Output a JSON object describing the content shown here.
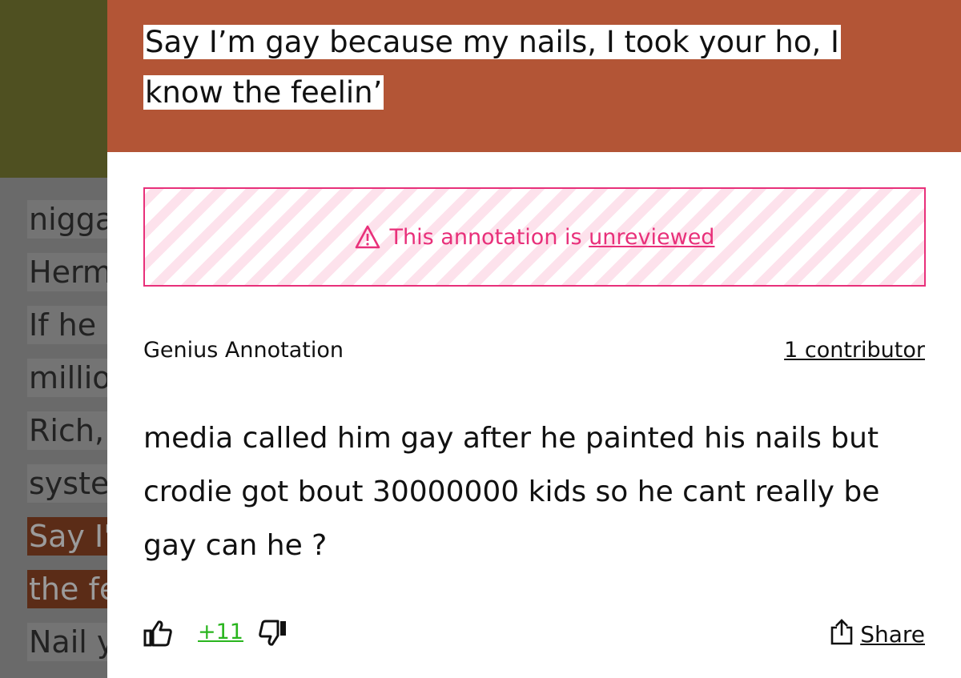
{
  "background_lyrics": [
    {
      "text": "nigga",
      "highlight": false
    },
    {
      "text": "Herm",
      "highlight": false
    },
    {
      "text": "If he",
      "highlight": false
    },
    {
      "text": "millio",
      "highlight": false
    },
    {
      "text": "Rich,",
      "highlight": false
    },
    {
      "text": "syste",
      "highlight": false
    },
    {
      "text": "Say I'",
      "highlight": true
    },
    {
      "text": "the fe",
      "highlight": true
    },
    {
      "text": "Nail y",
      "highlight": false
    }
  ],
  "annotation": {
    "lyric": "Say I’m gay because my nails, I took your ho, I know the feelin’",
    "warning_prefix": "This annotation is ",
    "warning_link": "unreviewed",
    "label": "Genius Annotation",
    "contributors": "1 contributor",
    "body": "media called him gay after he painted his nails but crodie got bout 30000000 kids so he cant really be gay can he ?",
    "vote_count": "+11",
    "share_label": "Share"
  },
  "colors": {
    "header_bg": "#b35536",
    "warning": "#e8307a",
    "vote_positive": "#29b51e"
  }
}
